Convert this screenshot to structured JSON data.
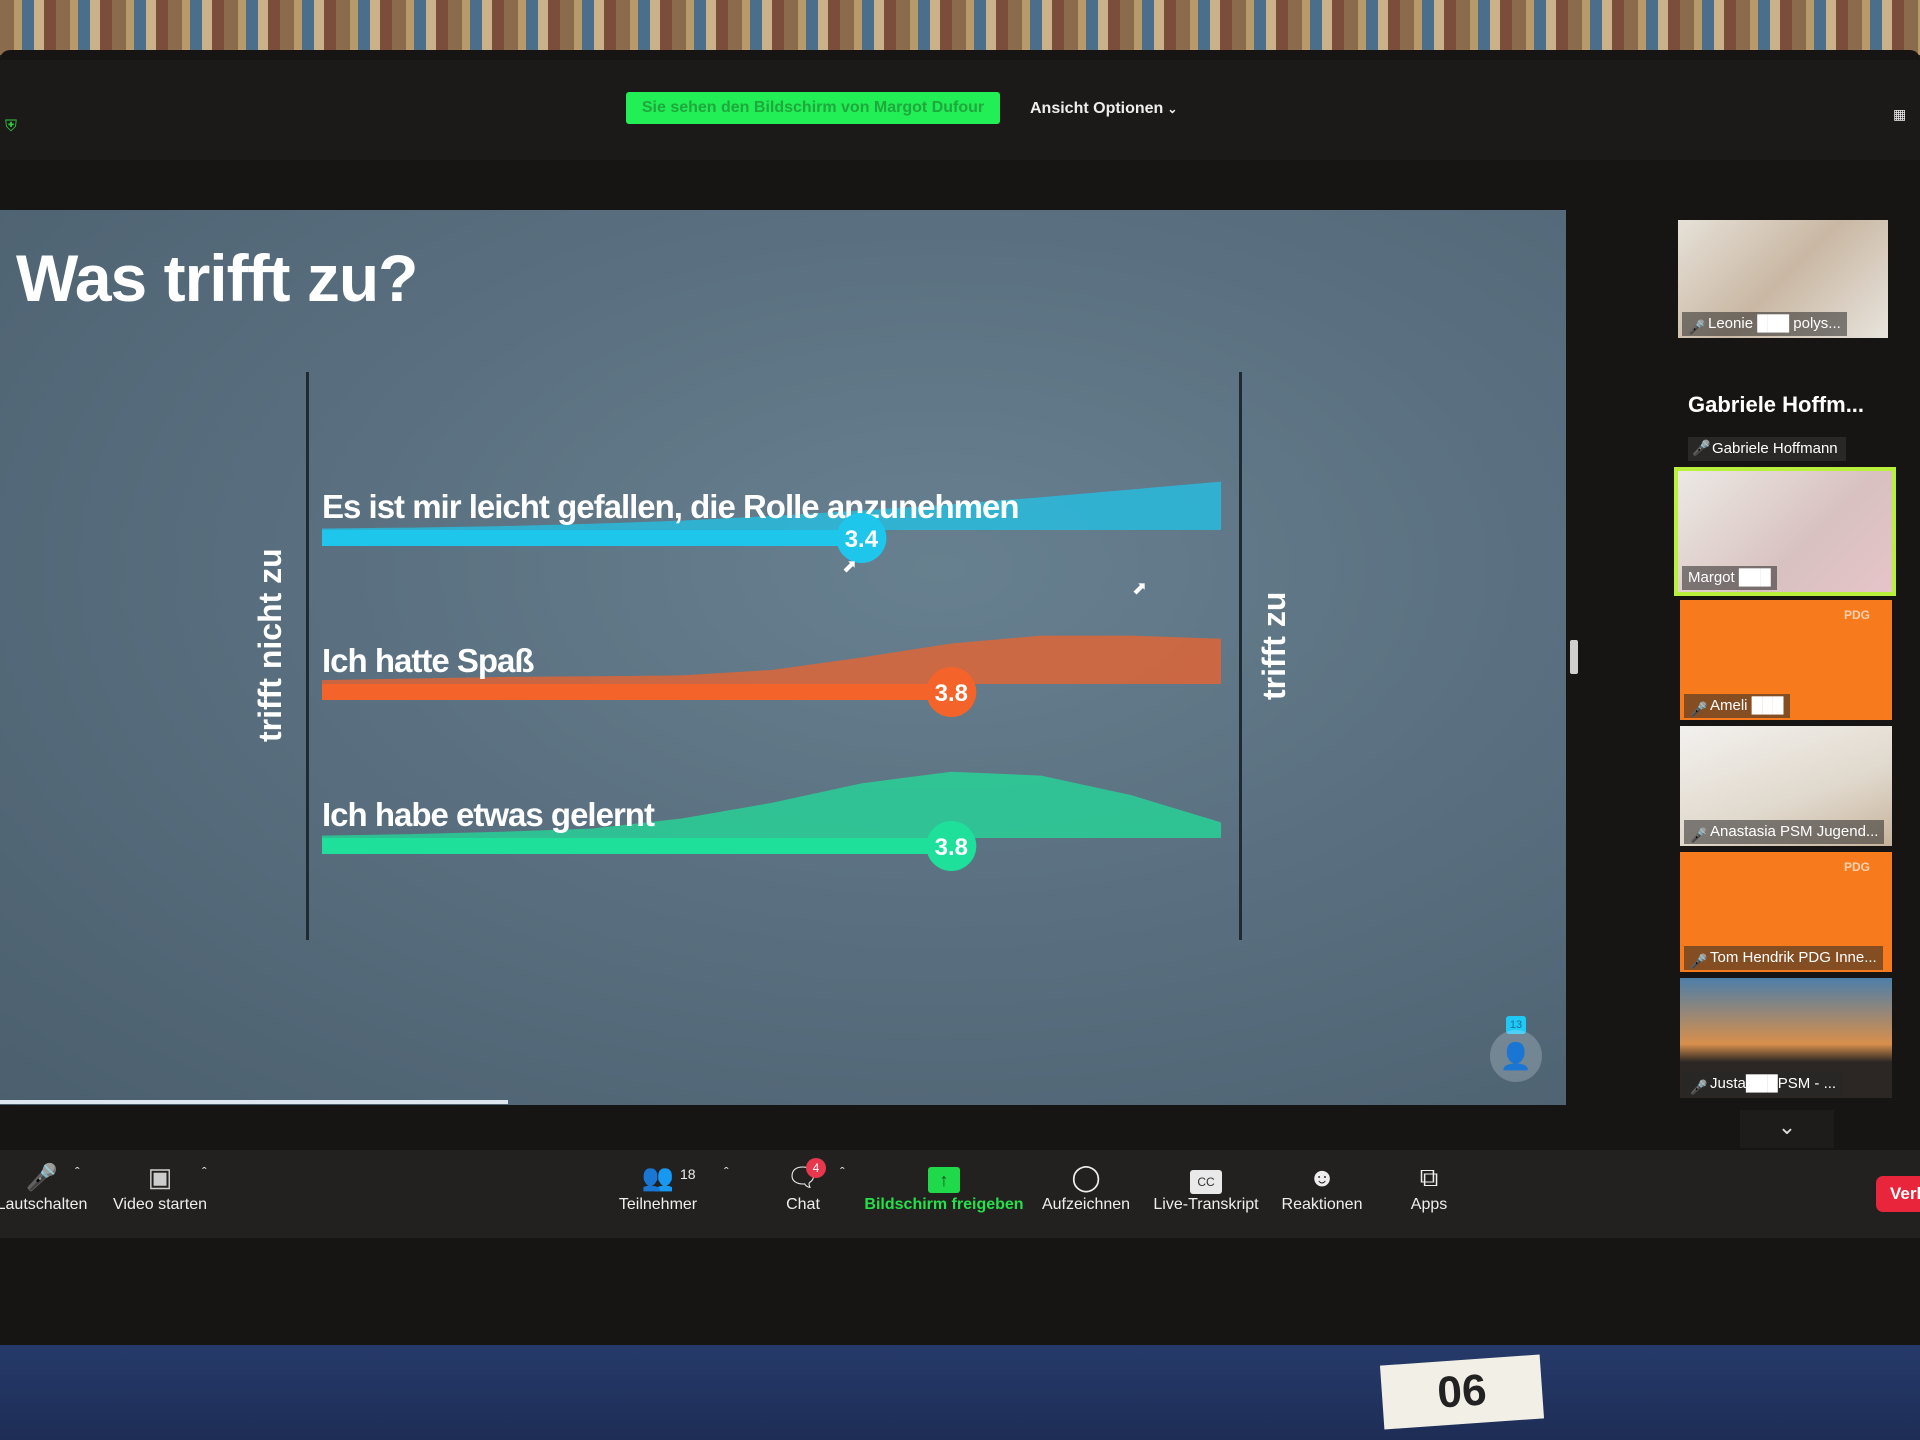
{
  "window": {
    "sharing_banner": "Sie sehen den Bildschirm von Margot Dufour",
    "view_options": "Ansicht Optionen",
    "layout_icon": "gallery-layout-icon"
  },
  "slide": {
    "title": "Was trifft zu?",
    "axis_left_label": "trifft nicht zu",
    "axis_right_label": "trifft zu",
    "audience_count": "13"
  },
  "chart_data": {
    "type": "bar",
    "title": "Was trifft zu?",
    "xlabel_left": "trifft nicht zu",
    "xlabel_right": "trifft zu",
    "scale": [
      1,
      5
    ],
    "categories": [
      "Es ist mir leicht gefallen, die Rolle anzunehmen",
      "Ich hatte Spaß",
      "Ich habe etwas gelernt"
    ],
    "values": [
      3.4,
      3.8,
      3.8
    ],
    "colors": [
      "#1fc6ec",
      "#f4632a",
      "#1fe09a"
    ],
    "distribution_shape": [
      [
        0.02,
        0.03,
        0.05,
        0.08,
        0.12,
        0.18,
        0.25,
        0.33,
        0.42,
        0.52,
        0.62
      ],
      [
        0.05,
        0.07,
        0.09,
        0.1,
        0.11,
        0.18,
        0.34,
        0.52,
        0.62,
        0.62,
        0.58
      ],
      [
        0.03,
        0.05,
        0.08,
        0.12,
        0.25,
        0.45,
        0.7,
        0.85,
        0.8,
        0.55,
        0.2
      ]
    ]
  },
  "gallery": {
    "tiles": [
      {
        "name": "Leonie ███ polys...",
        "label_tag": ""
      },
      {
        "name": "Margot ███",
        "label_tag": ""
      },
      {
        "name": "Ameli ███",
        "label_tag": "PDG"
      },
      {
        "name": "Anastasia PSM Jugend...",
        "label_tag": ""
      },
      {
        "name": "Tom Hendrik PDG Inne...",
        "label_tag": "PDG"
      },
      {
        "name": "Justa███PSM - ...",
        "label_tag": ""
      }
    ],
    "speaker_card_title": "Gabriele Hoffm...",
    "speaker_card_name": "Gabriele Hoffmann",
    "scroll_down": "⌄"
  },
  "toolbar": {
    "mute": "Lautschalten",
    "video": "Video starten",
    "participants": "Teilnehmer",
    "participants_count": "18",
    "chat": "Chat",
    "chat_badge": "4",
    "share": "Bildschirm freigeben",
    "record": "Aufzeichnen",
    "transcript": "Live-Transkript",
    "transcript_icon_text": "CC",
    "reactions": "Reaktionen",
    "apps": "Apps",
    "leave": "Verl"
  },
  "misc": {
    "sticker": "06"
  }
}
